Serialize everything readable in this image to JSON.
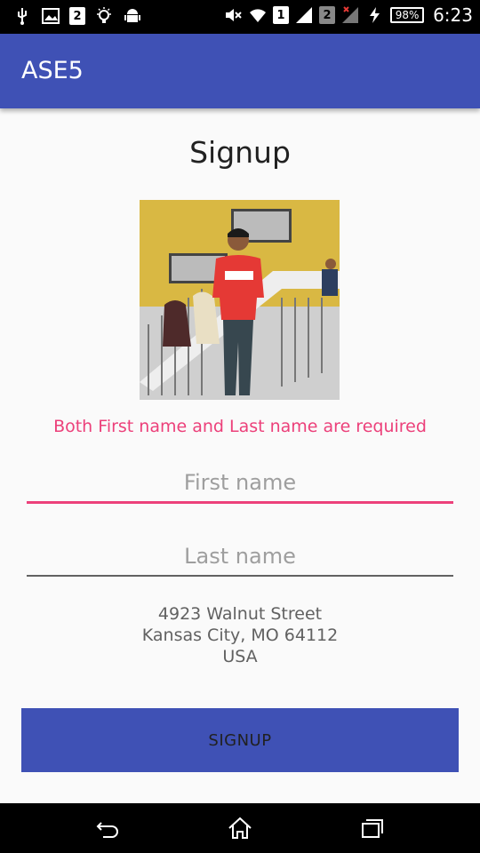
{
  "status_bar": {
    "sim1_label": "1",
    "sim2_label": "2",
    "notification_badge": "2",
    "battery_level": "98%",
    "time": "6:23",
    "icons": [
      "usb-icon",
      "image-icon",
      "notification-badge",
      "lightbulb-icon",
      "android-icon",
      "mute-icon",
      "wifi-icon",
      "signal-icon",
      "charging-icon",
      "battery-icon"
    ]
  },
  "app_bar": {
    "title": "ASE5"
  },
  "screen": {
    "title": "Signup",
    "error_message": "Both First name and Last name are required"
  },
  "form": {
    "first_name": {
      "value": "",
      "placeholder": "First name"
    },
    "last_name": {
      "value": "",
      "placeholder": "Last name"
    }
  },
  "address": {
    "line1": "4923 Walnut Street",
    "line2": "Kansas City, MO 64112",
    "line3": "USA"
  },
  "actions": {
    "signup_label": "SIGNUP"
  },
  "nav_bar": {
    "icons": [
      "back-icon",
      "home-icon",
      "recents-icon"
    ]
  },
  "colors": {
    "primary": "#3f51b5",
    "accent": "#ec407a",
    "background": "#fafafa"
  }
}
